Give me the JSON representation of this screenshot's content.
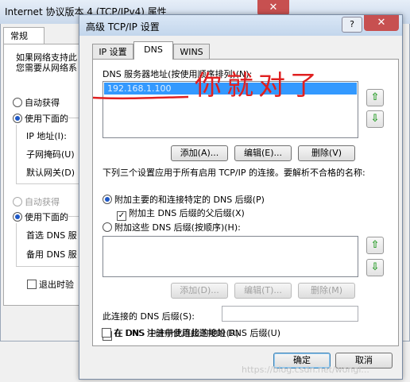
{
  "bg": {
    "title": "Internet 协议版本 4 (TCP/IPv4) 属性",
    "close": "✕",
    "tab": "常规",
    "text1": "如果网络支持此",
    "text2": "您需要从网络系",
    "auto_ip": "自动获得",
    "use_ip": "使用下面的",
    "ip_label": "IP 地址(I):",
    "mask_label": "子网掩码(U)",
    "gw_label": "默认网关(D)",
    "auto_dns": "自动获得",
    "use_dns": "使用下面的",
    "pref_dns": "首选 DNS 服",
    "alt_dns": "备用 DNS 服",
    "exit_validate": "退出时验"
  },
  "dlg": {
    "title": "高级 TCP/IP 设置",
    "help": "?",
    "close": "✕",
    "tabs": [
      "IP 设置",
      "DNS",
      "WINS"
    ],
    "dns_list_label": "DNS 服务器地址(按使用顺序排列)(N):",
    "dns_entry": "192.168.1.100",
    "annotation": "你就对了",
    "add_btn": "添加(A)...",
    "edit_btn": "编辑(E)...",
    "remove_btn": "删除(V)",
    "desc": "下列三个设置应用于所有启用 TCP/IP 的连接。要解析不合格的名称:",
    "radio_primary": "附加主要的和连接特定的 DNS 后缀(P)",
    "chk_parent": "附加主 DNS 后缀的父后缀(X)",
    "radio_these": "附加这些 DNS 后缀(按顺序)(H):",
    "add_btn2": "添加(D)...",
    "edit_btn2": "编辑(T)...",
    "remove_btn2": "删除(M)",
    "suffix_label": "此连接的 DNS 后缀(S):",
    "chk_register": "在 DNS 中注册此连接的地址(R)",
    "chk_use_suffix": "在 DNS 注册中使用此连接的 DNS 后缀(U)",
    "ok": "确定",
    "cancel": "取消",
    "watermark": "https://blog.csdn.net/wongi..."
  }
}
